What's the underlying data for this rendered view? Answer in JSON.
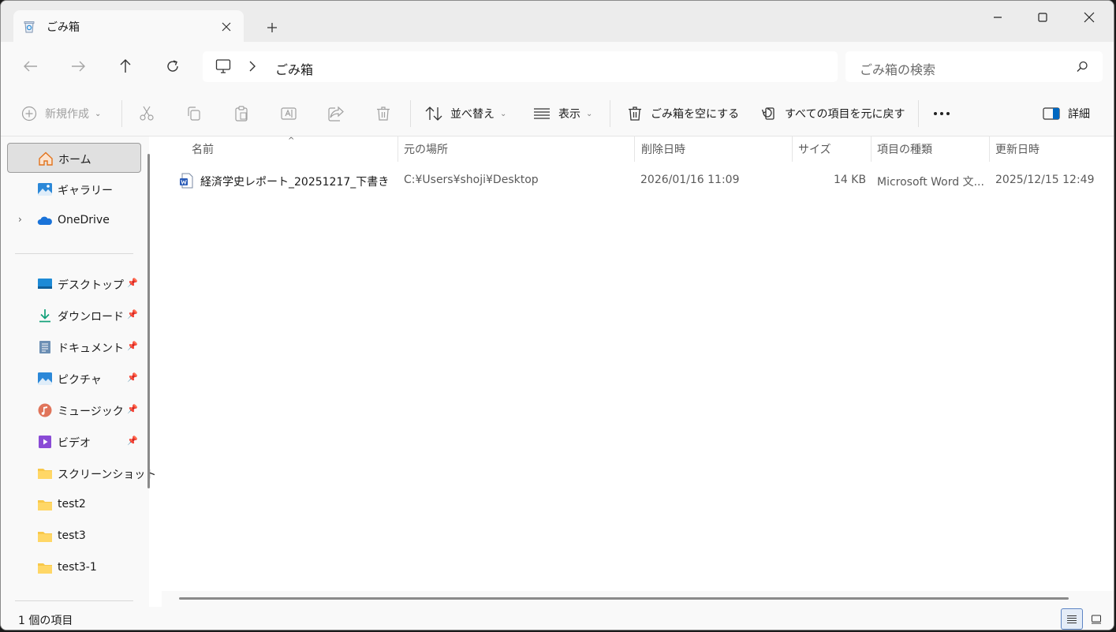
{
  "tab": {
    "title": "ごみ箱",
    "icon": "recycle-bin-icon"
  },
  "address": {
    "location": "ごみ箱"
  },
  "search": {
    "placeholder": "ごみ箱の検索"
  },
  "commands": {
    "new": "新規作成",
    "sort": "並べ替え",
    "view": "表示",
    "empty_bin": "ごみ箱を空にする",
    "restore_all": "すべての項目を元に戻す",
    "details": "詳細"
  },
  "sidebar": {
    "top": [
      {
        "label": "ホーム",
        "icon": "home-icon",
        "selected": true
      },
      {
        "label": "ギャラリー",
        "icon": "gallery-icon"
      },
      {
        "label": "OneDrive",
        "icon": "onedrive-icon"
      }
    ],
    "quick": [
      {
        "label": "デスクトップ",
        "icon": "desktop-icon",
        "pinned": true
      },
      {
        "label": "ダウンロード",
        "icon": "download-icon",
        "pinned": true
      },
      {
        "label": "ドキュメント",
        "icon": "document-icon",
        "pinned": true
      },
      {
        "label": "ピクチャ",
        "icon": "pictures-icon",
        "pinned": true
      },
      {
        "label": "ミュージック",
        "icon": "music-icon",
        "pinned": true
      },
      {
        "label": "ビデオ",
        "icon": "video-icon",
        "pinned": true
      },
      {
        "label": "スクリーンショット",
        "icon": "folder-icon"
      },
      {
        "label": "test2",
        "icon": "folder-icon"
      },
      {
        "label": "test3",
        "icon": "folder-icon"
      },
      {
        "label": "test3-1",
        "icon": "folder-icon"
      }
    ]
  },
  "columns": [
    "名前",
    "元の場所",
    "削除日時",
    "サイズ",
    "項目の種類",
    "更新日時"
  ],
  "rows": [
    {
      "name": "経済学史レポート_20251217_下書き",
      "location": "C:¥Users¥shoji¥Desktop",
      "deleted": "2026/01/16 11:09",
      "size": "14 KB",
      "type": "Microsoft Word 文...",
      "modified": "2025/12/15 12:49",
      "icon": "word-document-icon"
    }
  ],
  "status": {
    "count": "1 個の項目"
  },
  "colors": {
    "accent": "#0067c0",
    "folder": "#f8c84a"
  }
}
